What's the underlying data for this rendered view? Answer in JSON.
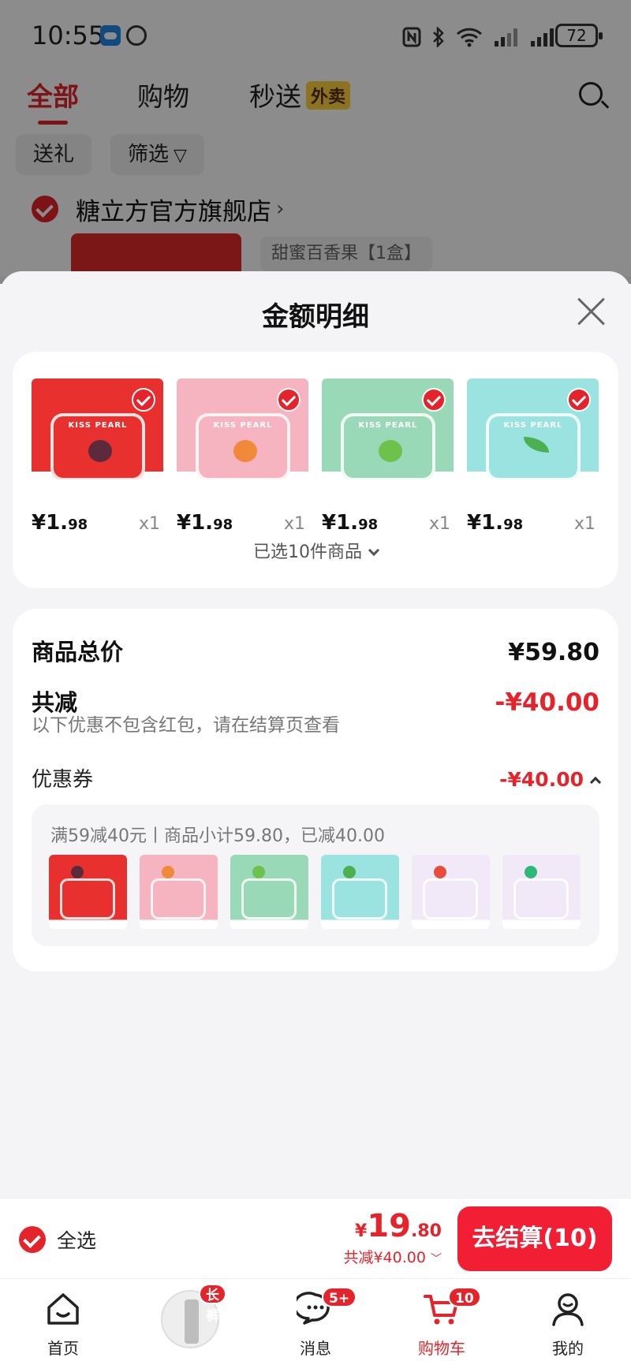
{
  "status_bar": {
    "time": "10:55",
    "battery": "72"
  },
  "top_tabs": {
    "all": "全部",
    "shopping": "购物",
    "express": "秒送",
    "express_badge": "外卖"
  },
  "chips": {
    "gift": "送礼",
    "filter": "筛选"
  },
  "store": {
    "name": "糖立方官方旗舰店",
    "spec": "甜蜜百香果【1盒】"
  },
  "sheet": {
    "title": "金额明细",
    "products": [
      {
        "name": "passion fruit mint",
        "price_int": "¥1.",
        "price_dec": "98",
        "qty": "x1",
        "color": "#e8302f",
        "accent": "#5b2a3b"
      },
      {
        "name": "peach mint",
        "price_int": "¥1.",
        "price_dec": "98",
        "qty": "x1",
        "color": "#f6b3c0",
        "accent": "#f08a3a"
      },
      {
        "name": "lime mint",
        "price_int": "¥1.",
        "price_dec": "98",
        "qty": "x1",
        "color": "#9ad9b8",
        "accent": "#6cc24a"
      },
      {
        "name": "spearmint",
        "price_int": "¥1.",
        "price_dec": "98",
        "qty": "x1",
        "color": "#9ae3e0",
        "accent": "#4caf50"
      }
    ],
    "selected_count": "已选10件商品",
    "summary": {
      "total_label": "商品总价",
      "total_value": "¥59.80",
      "discount_label": "共减",
      "discount_value": "-¥40.00",
      "discount_note": "以下优惠不包含红包，请在结算页查看",
      "coupon_label": "优惠券",
      "coupon_value": "-¥40.00",
      "coupon_detail": "满59减40元丨商品小计59.80，已减40.00"
    },
    "coupon_items": [
      {
        "color": "#e8302f",
        "accent": "#5b2a3b"
      },
      {
        "color": "#f6b3c0",
        "accent": "#f08a3a"
      },
      {
        "color": "#9ad9b8",
        "accent": "#6cc24a"
      },
      {
        "color": "#9ae3e0",
        "accent": "#4caf50"
      },
      {
        "color": "#f1e9f7",
        "accent": "#e74c3c"
      },
      {
        "color": "#f1e9f7",
        "accent": "#2eb87a"
      }
    ]
  },
  "checkout": {
    "select_all": "全选",
    "currency": "¥",
    "price_big": "19",
    "price_small": ".80",
    "discount": "共减¥40.00",
    "button": "去结算(10)"
  },
  "bottom_nav": {
    "home": "首页",
    "promo_badge": "长裤",
    "messages": "消息",
    "messages_badge": "5+",
    "cart": "购物车",
    "cart_badge": "10",
    "me": "我的"
  },
  "colors": {
    "accent": "#e5232a",
    "checkout_button": "#f21e34"
  }
}
